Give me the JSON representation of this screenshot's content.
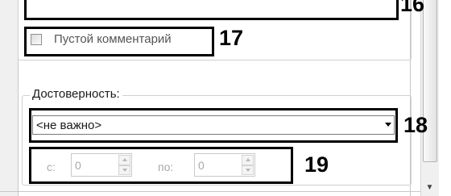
{
  "callouts": {
    "c16": "16",
    "c17": "17",
    "c18": "18",
    "c19": "19"
  },
  "empty_comment": {
    "label": "Пустой комментарий",
    "checked": false
  },
  "reliability": {
    "legend": "Достоверность:",
    "selected": "<не важно>",
    "from_label": "с:",
    "from_value": "0",
    "to_label": "по:",
    "to_value": "0",
    "range_enabled": false
  },
  "colors": {
    "highlight": "#000000",
    "disabled_text": "#a8a8a8",
    "border": "#d0d0d0"
  },
  "icons": {
    "scroll_down": "triangle-down-icon",
    "dropdown": "chevron-down-icon",
    "spin_up": "triangle-up-icon",
    "spin_down": "triangle-down-icon"
  }
}
